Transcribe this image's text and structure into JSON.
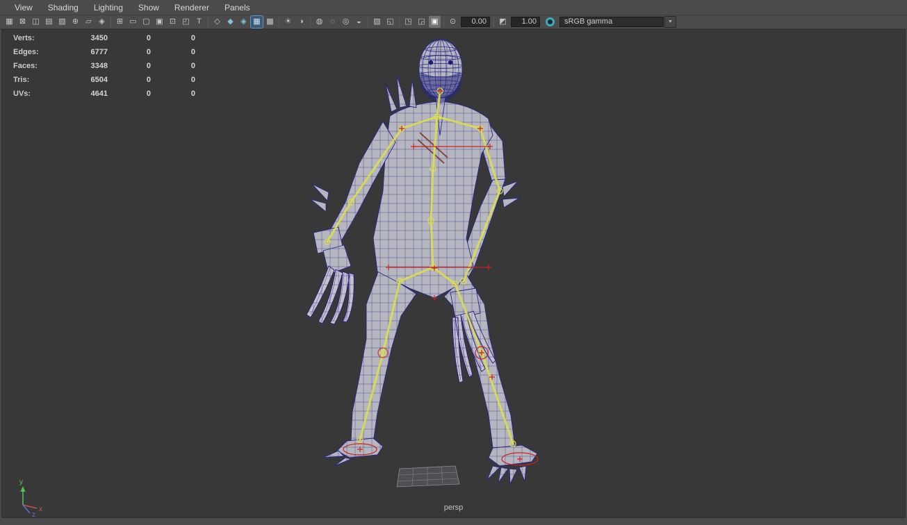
{
  "menu_bar": {
    "items": [
      "View",
      "Shading",
      "Lighting",
      "Show",
      "Renderer",
      "Panels"
    ]
  },
  "toolbar": {
    "groups": [
      {
        "name": "camera-tools",
        "icons": [
          {
            "name": "select-camera",
            "glyph": "▦"
          },
          {
            "name": "lock-camera",
            "glyph": "⊠"
          },
          {
            "name": "camera-attributes",
            "glyph": "◫"
          },
          {
            "name": "bookmarks",
            "glyph": "▤"
          },
          {
            "name": "image-plane",
            "glyph": "▧"
          },
          {
            "name": "2d-pan-zoom",
            "glyph": "⊕"
          },
          {
            "name": "grease-pencil",
            "glyph": "▱"
          },
          {
            "name": "snapshot",
            "glyph": "◈"
          }
        ]
      },
      {
        "name": "gates",
        "icons": [
          {
            "name": "grid",
            "glyph": "⊞"
          },
          {
            "name": "film-gate",
            "glyph": "▭"
          },
          {
            "name": "resolution-gate",
            "glyph": "▢"
          },
          {
            "name": "gate-mask",
            "glyph": "▣"
          },
          {
            "name": "field-chart",
            "glyph": "⊡"
          },
          {
            "name": "safe-action",
            "glyph": "◰"
          },
          {
            "name": "safe-title",
            "glyph": "T"
          }
        ]
      },
      {
        "name": "shading",
        "icons": [
          {
            "name": "wireframe",
            "glyph": "◇"
          },
          {
            "name": "smooth-shade-all",
            "glyph": "◆",
            "tint": "teal"
          },
          {
            "name": "textured",
            "glyph": "◈",
            "tint": "teal"
          },
          {
            "name": "wireframe-on-shaded",
            "glyph": "▦",
            "tint": "teal",
            "state": "active"
          },
          {
            "name": "use-default-material",
            "glyph": "▩"
          }
        ]
      },
      {
        "name": "lighting",
        "icons": [
          {
            "name": "all-lights",
            "glyph": "☀"
          },
          {
            "name": "shadows",
            "glyph": "◑"
          }
        ]
      },
      {
        "name": "render-effects",
        "icons": [
          {
            "name": "screen-space-ao",
            "glyph": "◍"
          },
          {
            "name": "motion-blur",
            "glyph": "◌"
          },
          {
            "name": "anti-aliasing",
            "glyph": "◎"
          },
          {
            "name": "depth-of-field",
            "glyph": "◒"
          }
        ]
      },
      {
        "name": "isolate",
        "icons": [
          {
            "name": "isolate-select",
            "glyph": "▨"
          },
          {
            "name": "viewport-mask",
            "glyph": "◱"
          }
        ]
      },
      {
        "name": "buffers",
        "icons": [
          {
            "name": "copy-buffer",
            "glyph": "◳"
          },
          {
            "name": "paste-buffer",
            "glyph": "◲"
          },
          {
            "name": "buffer-mode",
            "glyph": "▣",
            "state": "pressed"
          }
        ]
      }
    ],
    "exposure": {
      "icon_glyph": "⊙",
      "value": "0.00"
    },
    "gamma": {
      "icon_glyph": "◩",
      "value": "1.00"
    },
    "color_management": {
      "view_transform": "sRGB gamma",
      "arrow_glyph": "▼"
    }
  },
  "hud": {
    "rows": [
      {
        "label": "Verts:",
        "total": "3450",
        "col2": "0",
        "col3": "0"
      },
      {
        "label": "Edges:",
        "total": "6777",
        "col2": "0",
        "col3": "0"
      },
      {
        "label": "Faces:",
        "total": "3348",
        "col2": "0",
        "col3": "0"
      },
      {
        "label": "Tris:",
        "total": "6504",
        "col2": "0",
        "col3": "0"
      },
      {
        "label": "UVs:",
        "total": "4641",
        "col2": "0",
        "col3": "0"
      }
    ]
  },
  "viewport": {
    "camera_label": "persp",
    "axis_labels": {
      "x": "x",
      "y": "y",
      "z": "z"
    }
  },
  "colors": {
    "viewport_background": "#383838",
    "wireframe": "#26268c",
    "skeleton": "#dcdc52",
    "manipulator": "#cc2222",
    "active_tool_highlight": "#3d5a74",
    "view_transform_accent": "#3fa8bf"
  }
}
